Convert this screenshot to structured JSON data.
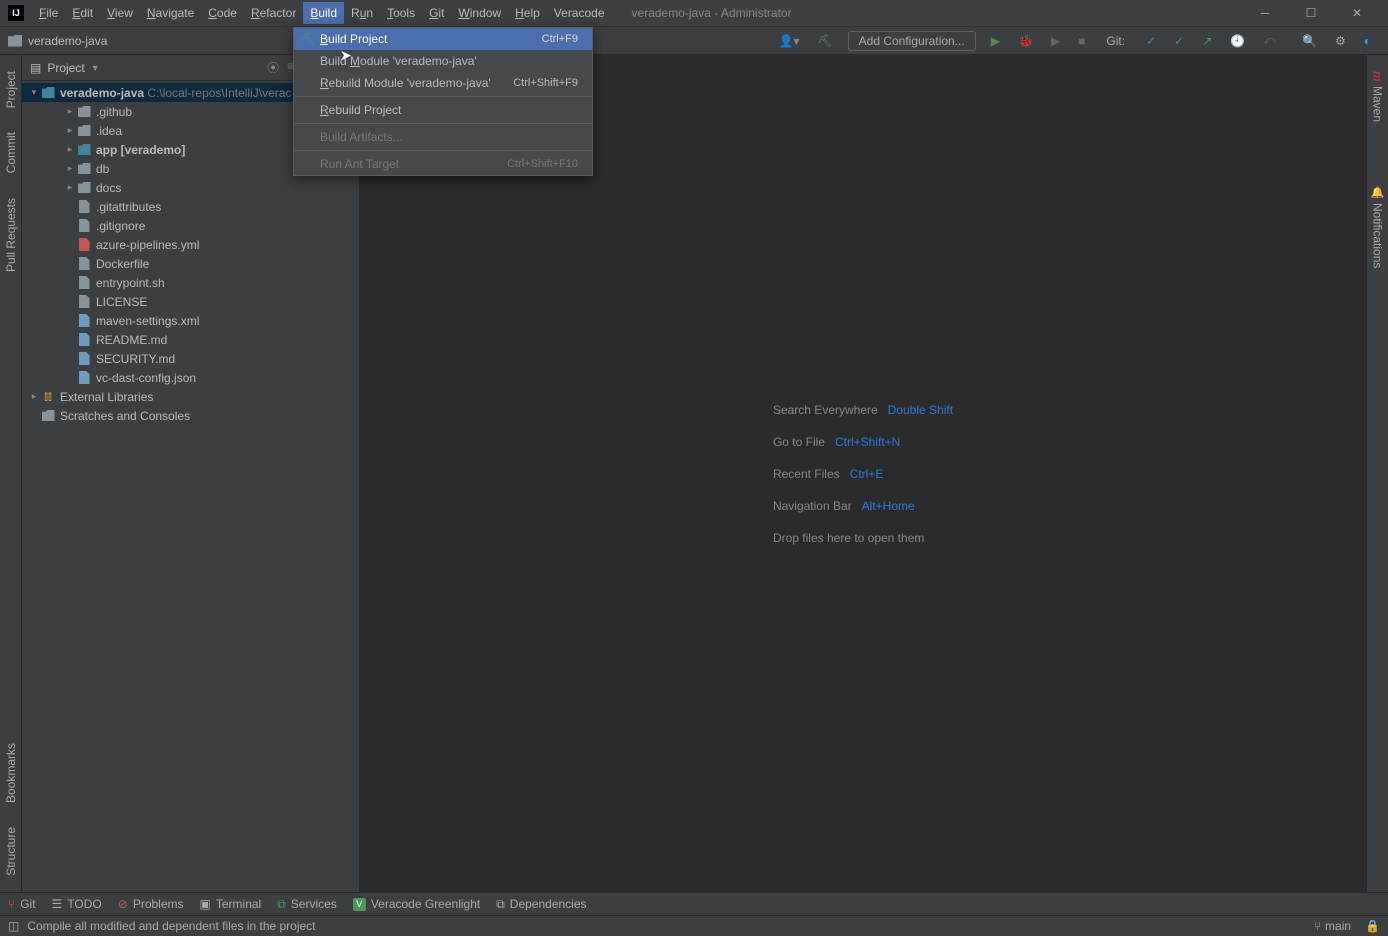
{
  "titlebar": {
    "menus": [
      "File",
      "Edit",
      "View",
      "Navigate",
      "Code",
      "Refactor",
      "Build",
      "Run",
      "Tools",
      "Git",
      "Window",
      "Help",
      "Veracode"
    ],
    "mnemonics": [
      "F",
      "E",
      "V",
      "N",
      "C",
      "R",
      "B",
      "u",
      "T",
      "G",
      "W",
      "H",
      ""
    ],
    "active_index": 6,
    "title": "verademo-java - Administrator"
  },
  "toolbar": {
    "breadcrumb": "verademo-java",
    "add_config": "Add Configuration...",
    "git_label": "Git:"
  },
  "dropdown": {
    "items": [
      {
        "label": "Build Project",
        "shortcut": "Ctrl+F9",
        "mnemonic": "B",
        "icon": "hammer",
        "selected": true
      },
      {
        "label": "Build Module 'verademo-java'",
        "shortcut": "",
        "mnemonic": "M"
      },
      {
        "label": "Rebuild Module 'verademo-java'",
        "shortcut": "Ctrl+Shift+F9",
        "mnemonic": "R"
      },
      {
        "sep": true
      },
      {
        "label": "Rebuild Project",
        "shortcut": "",
        "mnemonic": "R"
      },
      {
        "sep": true
      },
      {
        "label": "Build Artifacts...",
        "shortcut": "",
        "disabled": true
      },
      {
        "sep": true
      },
      {
        "label": "Run Ant Target",
        "shortcut": "Ctrl+Shift+F10",
        "disabled": true
      }
    ]
  },
  "project_panel": {
    "title": "Project",
    "root": {
      "name": "verademo-java",
      "path": "C:\\local-repos\\IntelliJ\\verac"
    },
    "children": [
      {
        "type": "folder",
        "name": ".github",
        "depth": 1,
        "expandable": true
      },
      {
        "type": "folder",
        "name": ".idea",
        "depth": 1,
        "expandable": true
      },
      {
        "type": "folder",
        "name": "app",
        "suffix": "[verademo]",
        "depth": 1,
        "bold": true,
        "blue": true,
        "expandable": true
      },
      {
        "type": "folder",
        "name": "db",
        "depth": 1,
        "expandable": true
      },
      {
        "type": "folder",
        "name": "docs",
        "depth": 1,
        "expandable": true
      },
      {
        "type": "file",
        "name": ".gitattributes",
        "depth": 1
      },
      {
        "type": "file",
        "name": ".gitignore",
        "depth": 1
      },
      {
        "type": "file",
        "name": "azure-pipelines.yml",
        "depth": 1,
        "cls": "yml"
      },
      {
        "type": "file",
        "name": "Dockerfile",
        "depth": 1
      },
      {
        "type": "file",
        "name": "entrypoint.sh",
        "depth": 1
      },
      {
        "type": "file",
        "name": "LICENSE",
        "depth": 1
      },
      {
        "type": "file",
        "name": "maven-settings.xml",
        "depth": 1,
        "cls": "cfg"
      },
      {
        "type": "file",
        "name": "README.md",
        "depth": 1,
        "cls": "cfg"
      },
      {
        "type": "file",
        "name": "SECURITY.md",
        "depth": 1,
        "cls": "cfg"
      },
      {
        "type": "file",
        "name": "vc-dast-config.json",
        "depth": 1,
        "cls": "cfg"
      }
    ],
    "external": "External Libraries",
    "scratches": "Scratches and Consoles"
  },
  "left_gutter": [
    "Project",
    "Commit",
    "Pull Requests",
    "Structure",
    "Bookmarks"
  ],
  "right_gutter": [
    "Maven",
    "Notifications"
  ],
  "hints": [
    {
      "label": "Search Everywhere",
      "key": "Double Shift"
    },
    {
      "label": "Go to File",
      "key": "Ctrl+Shift+N"
    },
    {
      "label": "Recent Files",
      "key": "Ctrl+E"
    },
    {
      "label": "Navigation Bar",
      "key": "Alt+Home"
    },
    {
      "label": "Drop files here to open them",
      "key": ""
    }
  ],
  "bottom_tools": [
    "Git",
    "TODO",
    "Problems",
    "Terminal",
    "Services",
    "Veracode Greenlight",
    "Dependencies"
  ],
  "statusbar": {
    "message": "Compile all modified and dependent files in the project",
    "branch": "main"
  }
}
